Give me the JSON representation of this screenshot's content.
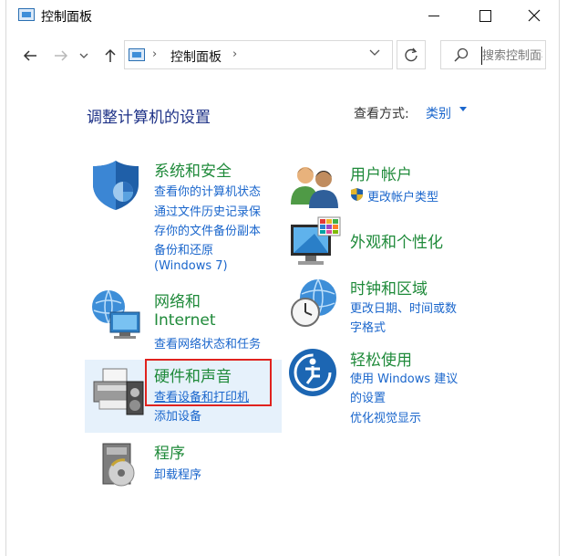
{
  "window": {
    "title": "控制面板"
  },
  "address": {
    "path": "控制面板",
    "separator": "›"
  },
  "search": {
    "placeholder": "搜索控制面板"
  },
  "heading": "调整计算机的设置",
  "view": {
    "label": "查看方式:",
    "value": "类别"
  },
  "categories": {
    "system": {
      "title": "系统和安全",
      "links": [
        "查看你的计算机状态",
        "通过文件历史记录保",
        "存你的文件备份副本",
        "备份和还原",
        "(Windows 7)"
      ]
    },
    "network": {
      "title_line1": "网络和",
      "title_line2": "Internet",
      "links": [
        "查看网络状态和任务"
      ]
    },
    "hardware": {
      "title": "硬件和声音",
      "links": [
        "查看设备和打印机",
        "添加设备"
      ]
    },
    "programs": {
      "title": "程序",
      "links": [
        "卸载程序"
      ]
    },
    "users": {
      "title": "用户帐户",
      "links": [
        "更改帐户类型"
      ]
    },
    "appearance": {
      "title": "外观和个性化"
    },
    "clock": {
      "title": "时钟和区域",
      "links": [
        "更改日期、时间或数",
        "字格式"
      ]
    },
    "ease": {
      "title": "轻松使用",
      "links": [
        "使用 Windows 建议",
        "的设置",
        "优化视觉显示"
      ]
    }
  },
  "colors": {
    "accent": "#1a66cc",
    "category_green": "#1f8a3a",
    "heading_blue": "#1e3287",
    "highlight": "#e0221e"
  }
}
